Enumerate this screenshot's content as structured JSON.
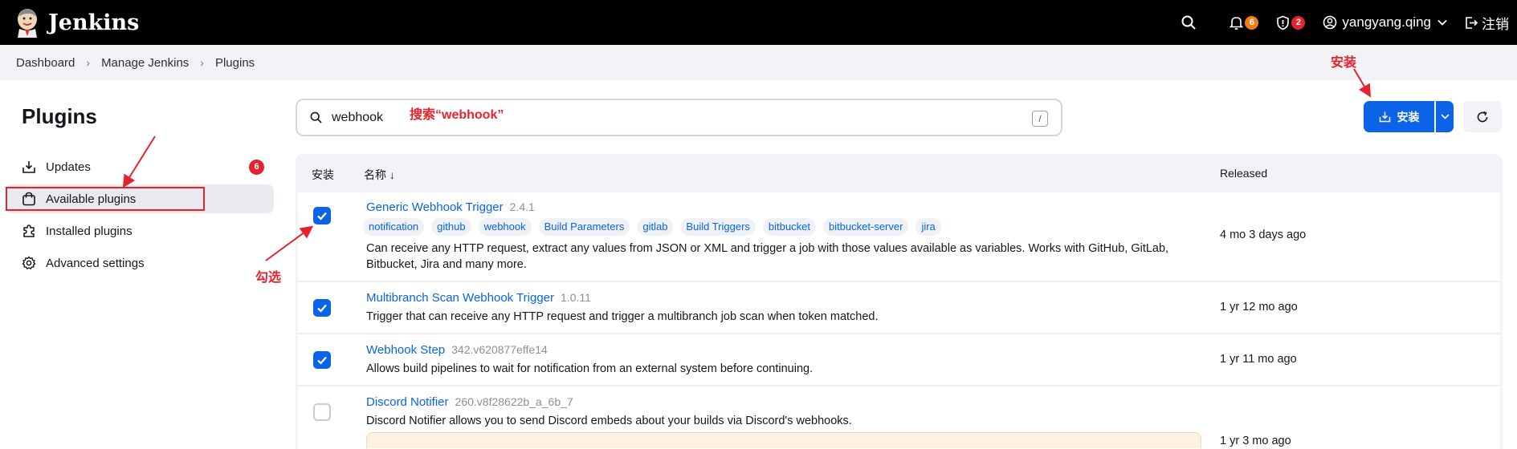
{
  "header": {
    "app_name": "Jenkins",
    "notifications_count": "6",
    "security_count": "2",
    "username": "yangyang.qing",
    "logout_label": "注销"
  },
  "breadcrumb": [
    "Dashboard",
    "Manage Jenkins",
    "Plugins"
  ],
  "sidebar": {
    "title": "Plugins",
    "items": [
      {
        "label": "Updates",
        "badge": "6"
      },
      {
        "label": "Available plugins"
      },
      {
        "label": "Installed plugins"
      },
      {
        "label": "Advanced settings"
      }
    ]
  },
  "search": {
    "value": "webhook",
    "shortcut": "/"
  },
  "toolbar": {
    "install_label": "安装"
  },
  "table": {
    "headers": {
      "install": "安装",
      "name": "名称 ↓",
      "released": "Released"
    },
    "rows": [
      {
        "checked": true,
        "name": "Generic Webhook Trigger",
        "version": "2.4.1",
        "tags": [
          "notification",
          "github",
          "webhook",
          "Build Parameters",
          "gitlab",
          "Build Triggers",
          "bitbucket",
          "bitbucket-server",
          "jira"
        ],
        "desc_line1": "Can receive any HTTP request, extract any values from JSON or XML and trigger a job with those values available as variables. Works with GitHub, GitLab,",
        "desc_line2": "Bitbucket, Jira and many more.",
        "released": "4 mo 3 days ago"
      },
      {
        "checked": true,
        "name": "Multibranch Scan Webhook Trigger",
        "version": "1.0.11",
        "desc_line1": "Trigger that can receive any HTTP request and trigger a multibranch job scan when token matched.",
        "released": "1 yr 12 mo ago"
      },
      {
        "checked": true,
        "name": "Webhook Step",
        "version": "342.v620877effe14",
        "desc_line1": "Allows build pipelines to wait for notification from an external system before continuing.",
        "released": "1 yr 11 mo ago"
      },
      {
        "checked": false,
        "name": "Discord Notifier",
        "version": "260.v8f28622b_a_6b_7",
        "desc_line1": "Discord Notifier allows you to send Discord embeds about your builds via Discord's webhooks.",
        "released": "1 yr 3 mo ago"
      }
    ]
  },
  "annotations": {
    "install": "安装",
    "search": "搜索“webhook”",
    "check": "勾选"
  },
  "colors": {
    "accent": "#0b63e5",
    "annotation": "#e5232e"
  }
}
